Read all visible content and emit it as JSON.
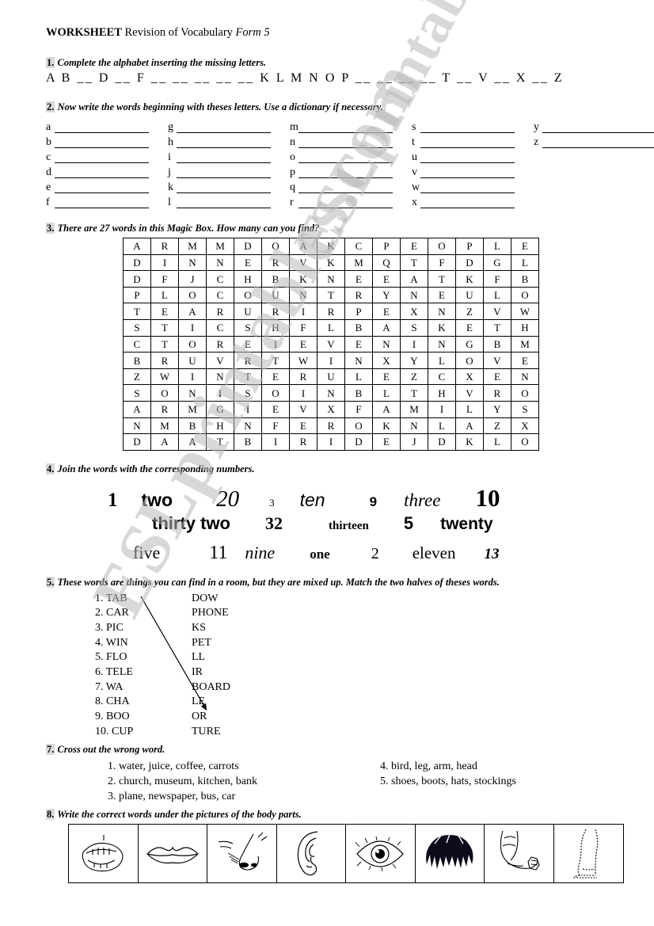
{
  "header": {
    "title_bold": "WORKSHEET",
    "title_regular": " Revision of Vocabulary ",
    "title_italic": "Form 5"
  },
  "q1": {
    "number": "1.",
    "heading": "Complete the alphabet inserting the missing letters.",
    "alphabet_line": "A B __ D __ F __ __ __ __ __ K L M N O P __ __ __ __ T __ V __ X __ Z"
  },
  "q2": {
    "number": "2.",
    "heading": "Now write the words beginning with theses letters. Use a dictionary if necessary.",
    "columns": [
      [
        "a",
        "b",
        "c",
        "d",
        "e",
        "f"
      ],
      [
        "g",
        "h",
        "i",
        "j",
        "k",
        "l"
      ],
      [
        "m",
        "n",
        "o",
        "p",
        "q",
        "r"
      ],
      [
        "s",
        "t",
        "u",
        "v",
        "w",
        "x"
      ],
      [
        "y",
        "z"
      ]
    ]
  },
  "q3": {
    "number": "3.",
    "heading": "There are 27 words in this Magic Box. How many can you find?",
    "word_count": 27,
    "grid": [
      [
        "A",
        "R",
        "M",
        "M",
        "D",
        "O",
        "A",
        "K",
        "C",
        "P",
        "E",
        "O",
        "P",
        "L",
        "E"
      ],
      [
        "D",
        "I",
        "N",
        "N",
        "E",
        "R",
        "V",
        "K",
        "M",
        "Q",
        "T",
        "F",
        "D",
        "G",
        "L"
      ],
      [
        "D",
        "F",
        "J",
        "C",
        "H",
        "B",
        "K",
        "N",
        "E",
        "E",
        "A",
        "T",
        "K",
        "F",
        "B"
      ],
      [
        "P",
        "L",
        "O",
        "C",
        "O",
        "U",
        "N",
        "T",
        "R",
        "Y",
        "N",
        "E",
        "U",
        "L",
        "O"
      ],
      [
        "T",
        "E",
        "A",
        "R",
        "U",
        "R",
        "I",
        "R",
        "P",
        "E",
        "X",
        "N",
        "Z",
        "V",
        "W"
      ],
      [
        "S",
        "T",
        "I",
        "C",
        "S",
        "H",
        "F",
        "L",
        "B",
        "A",
        "S",
        "K",
        "E",
        "T",
        "H"
      ],
      [
        "C",
        "T",
        "O",
        "R",
        "E",
        "I",
        "E",
        "V",
        "E",
        "N",
        "I",
        "N",
        "G",
        "B",
        "M"
      ],
      [
        "B",
        "R",
        "U",
        "V",
        "R",
        "T",
        "W",
        "I",
        "N",
        "X",
        "Y",
        "L",
        "O",
        "V",
        "E"
      ],
      [
        "Z",
        "W",
        "I",
        "N",
        "T",
        "E",
        "R",
        "U",
        "L",
        "E",
        "Z",
        "C",
        "X",
        "E",
        "N"
      ],
      [
        "S",
        "O",
        "N",
        "I",
        "S",
        "O",
        "I",
        "N",
        "B",
        "L",
        "T",
        "H",
        "V",
        "R",
        "O"
      ],
      [
        "A",
        "R",
        "M",
        "G",
        "I",
        "E",
        "V",
        "X",
        "F",
        "A",
        "M",
        "I",
        "L",
        "Y",
        "S"
      ],
      [
        "N",
        "M",
        "B",
        "H",
        "N",
        "F",
        "E",
        "R",
        "O",
        "K",
        "N",
        "L",
        "A",
        "Z",
        "X"
      ],
      [
        "D",
        "A",
        "A",
        "T",
        "B",
        "I",
        "R",
        "I",
        "D",
        "E",
        "J",
        "D",
        "K",
        "L",
        "O"
      ]
    ]
  },
  "q4": {
    "number": "4.",
    "heading": "Join the words with the corresponding numbers.",
    "row1": [
      "1",
      "two",
      "20",
      "3",
      "ten",
      "9",
      "three",
      "10"
    ],
    "row2": [
      "thirty two",
      "32",
      "thirteen",
      "5",
      "twenty"
    ],
    "row3": [
      "five",
      "11",
      "nine",
      "one",
      "2",
      "eleven",
      "13"
    ]
  },
  "q5": {
    "number": "5.",
    "heading": "These words are things you can find in a room, but they are mixed up. Match the two halves of theses words.",
    "left": [
      "1. TAB",
      "2. CAR",
      "3. PIC",
      "4. WIN",
      "5. FLO",
      "6. TELE",
      "7. WA",
      "8. CHA",
      "9. BOO",
      "10. CUP"
    ],
    "right": [
      "DOW",
      "PHONE",
      "KS",
      "PET",
      "LL",
      "IR",
      "BOARD",
      "LE",
      "OR",
      "TURE"
    ]
  },
  "q7": {
    "number": "7.",
    "heading": "Cross out the wrong word.",
    "left": [
      "1. water, juice, coffee, carrots",
      "2. church, museum, kitchen, bank",
      "3. plane, newspaper, bus, car"
    ],
    "right": [
      "4. bird, leg, arm, head",
      "5. shoes, boots, hats, stockings"
    ]
  },
  "q8": {
    "number": "8.",
    "heading": "Write the correct words under the pictures of the body parts.",
    "pictures": [
      "open-mouth-teeth-icon",
      "lips-icon",
      "nose-icon",
      "ear-icon",
      "eye-icon",
      "hair-icon",
      "arm-icon",
      "leg-foot-icon"
    ]
  },
  "watermark": {
    "line1": "ESLprintables.com",
    "line2": "ESLprintables.com"
  },
  "colors": {
    "ink": "#000000",
    "paper": "#ffffff",
    "number_highlight": "#d9d9d9",
    "watermark": "#b9b9b9"
  }
}
